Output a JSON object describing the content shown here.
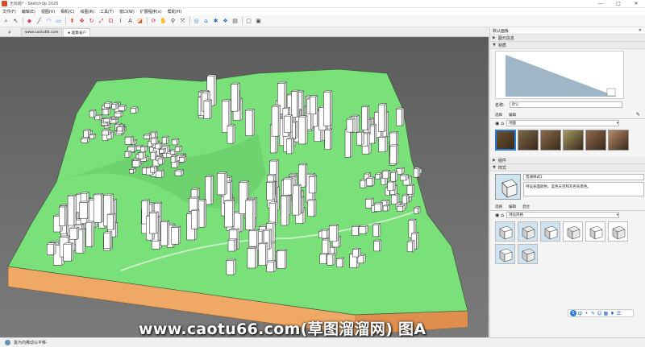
{
  "window": {
    "title": "无标题* - SketchUp 2025",
    "minimize": "—",
    "maximize": "□",
    "close": "✕"
  },
  "menu": [
    "文件(F)",
    "编辑(E)",
    "视图(V)",
    "相机(C)",
    "绘图(R)",
    "工具(T)",
    "窗口(W)",
    "扩展程序(x)",
    "帮助(H)"
  ],
  "toolbar_icons": [
    "search-icon",
    "select-icon",
    "eraser-icon",
    "line-icon",
    "arc-icon",
    "rectangle-icon",
    "pushpull-icon",
    "move-icon",
    "rotate-icon",
    "scale-icon",
    "offset-icon",
    "tape-icon",
    "text-icon",
    "paint-icon",
    "orbit-icon",
    "pan-icon",
    "zoom-icon",
    "zoom-extents-icon",
    "geolocation-icon",
    "warehouse-icon",
    "extension-icon",
    "components-icon",
    "layout-icon",
    "new-icon",
    "open-icon"
  ],
  "tabs": {
    "search_glyph": "⌕",
    "items": [
      {
        "label": "www.caotu66.com",
        "active": false
      },
      {
        "label": "★ 超集省户",
        "active": true
      }
    ]
  },
  "tray": {
    "title": "默认面板",
    "close": "✕",
    "sections": {
      "entity_info": "图元信息",
      "materials": "材质",
      "components": "组件",
      "styles": "样式"
    },
    "materials": {
      "name_label": "名称:",
      "name_value": "默认",
      "tab_select": "选择",
      "tab_edit": "编辑",
      "category": "地面",
      "swatch_colors": [
        "#6a5335",
        "#7d6648",
        "#8a6c4a",
        "#a39a62",
        "#8f6a4e",
        "#b88a6a"
      ]
    },
    "styles": {
      "name": "普通样式1",
      "description": "持设表面颜色。蓝色天空和灰色背景色。",
      "tab_select": "选择",
      "tab_edit": "编辑",
      "tab_mix": "混合",
      "category": "持设风格"
    }
  },
  "status": {
    "message": "拔为向推动以平移"
  },
  "watermark": "www.caotu66.com(草图溜溜网) 图A",
  "colors": {
    "terrain": "#7ae07a",
    "soil": "#f0a866",
    "building": "#ffffff",
    "accent": "#d94b2b"
  }
}
